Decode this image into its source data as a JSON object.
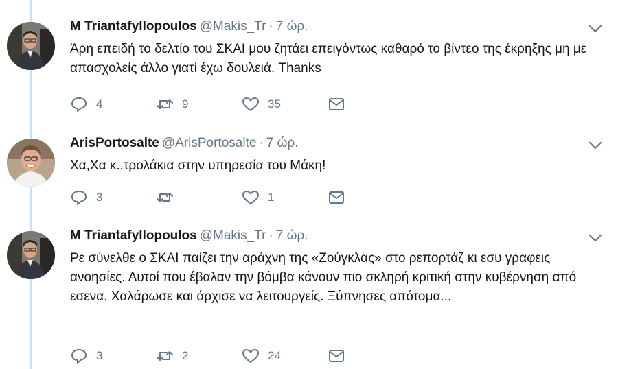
{
  "tweets": [
    {
      "avatar_icon": "profile-photo-man-glasses",
      "name": "M Triantafyllopoulos",
      "handle": "@Makis_Tr",
      "separator": "·",
      "time": "7 ώρ.",
      "text": "Άρη επειδή το δελτίο του ΣΚΑΙ μου ζητάει επειγόντως καθαρό το βίντεο της έκρηξης μη με απασχολείς άλλο γιατί έχω δουλειά. Thanks",
      "replies": "4",
      "retweets": "9",
      "likes": "35"
    },
    {
      "avatar_icon": "profile-photo-man-smiling",
      "name": "ArisPortosalte",
      "handle": "@ArisPortosalte",
      "separator": "·",
      "time": "7 ώρ.",
      "text": "Χα,Χα κ..τρολάκια στην υπηρεσία του Μάκη!",
      "replies": "3",
      "retweets": "",
      "likes": "1"
    },
    {
      "avatar_icon": "profile-photo-man-glasses",
      "name": "M Triantafyllopoulos",
      "handle": "@Makis_Tr",
      "separator": "·",
      "time": "7 ώρ.",
      "text": "Ρε σύνελθε ο ΣΚΑΙ παίζει την αράχνη της «Ζούγκλας» στο ρεπορτάζ κι εσυ γραφεις  ανοησίες. Αυτοί που έβαλαν την βόμβα κάνουν πιο σκληρή κριτική στην κυβέρνηση από εσενα. Χαλάρωσε και άρχισε να λειτουργείς. Ξύπνησες απότομα...",
      "replies": "3",
      "retweets": "2",
      "likes": "24"
    }
  ],
  "colors": {
    "thread_line": "#c4e5f9",
    "muted": "#657786",
    "text": "#14171a"
  }
}
